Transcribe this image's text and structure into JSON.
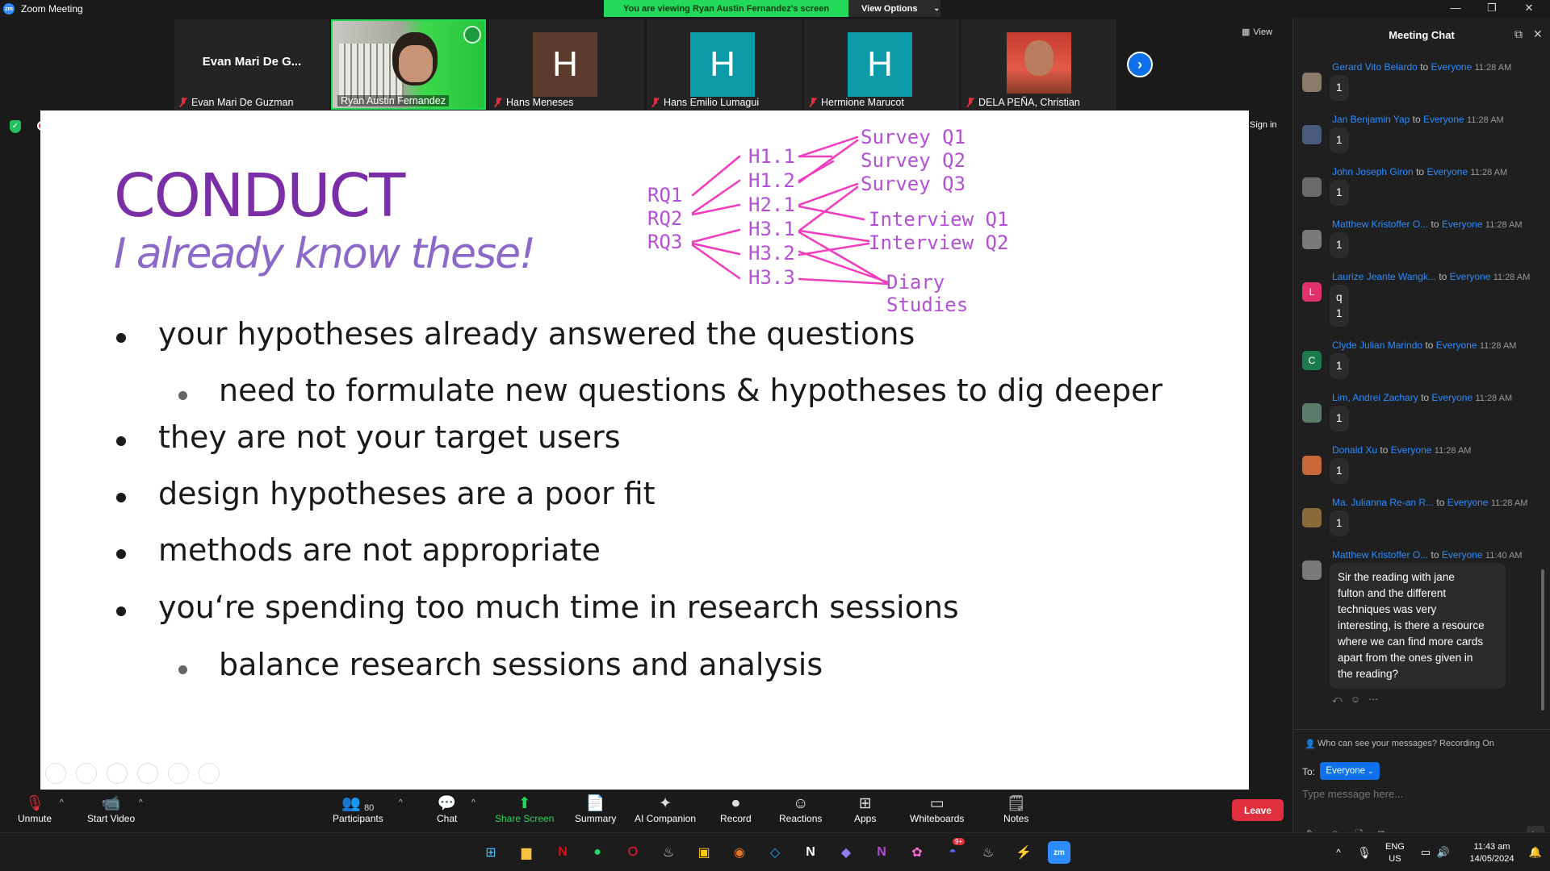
{
  "window": {
    "title": "Zoom Meeting",
    "logo_text": "zm"
  },
  "share_banner": {
    "viewing": "You are viewing Ryan Austin Fernandez's screen",
    "view_options": "View Options"
  },
  "gallery": {
    "view_label": "View",
    "participants": [
      {
        "name": "Evan Mari De Guzman",
        "big": "Evan Mari De G...",
        "type": "name"
      },
      {
        "name": "Ryan Austin Fernandez",
        "type": "video"
      },
      {
        "name": "Hans Meneses",
        "letter": "H",
        "color": "#5c3a2e"
      },
      {
        "name": "Hans Emilio Lumagui",
        "letter": "H",
        "color": "#0a9aa8"
      },
      {
        "name": "Hermione Marucot",
        "letter": "H",
        "color": "#0a9aa8"
      },
      {
        "name": "DELA PEÑA, Christian",
        "type": "video"
      }
    ]
  },
  "sign_in": "Sign in",
  "slide": {
    "title": "CONDUCT",
    "subtitle": "I already know these!",
    "bullets": [
      "your hypotheses already answered the questions",
      "need to formulate new questions & hypotheses to dig deeper",
      "they are not your target users",
      "design hypotheses are a poor fit",
      "methods are not appropriate",
      "you‘re spending too much time in research sessions",
      "balance research sessions and analysis"
    ],
    "diagram": {
      "rq": [
        "RQ1",
        "RQ2",
        "RQ3"
      ],
      "h": [
        "H1.1",
        "H1.2",
        "H2.1",
        "H3.1",
        "H3.2",
        "H3.3"
      ],
      "methods": [
        "Survey Q1",
        "Survey Q2",
        "Survey Q3",
        "Interview Q1",
        "Interview Q2",
        "Diary Studies"
      ]
    }
  },
  "toolbar": {
    "unmute": "Unmute",
    "start_video": "Start Video",
    "participants": "Participants",
    "participant_count": "80",
    "chat": "Chat",
    "share_screen": "Share Screen",
    "summary": "Summary",
    "ai_companion": "AI Companion",
    "record": "Record",
    "reactions": "Reactions",
    "apps": "Apps",
    "whiteboards": "Whiteboards",
    "notes": "Notes",
    "leave": "Leave"
  },
  "chat": {
    "title": "Meeting Chat",
    "messages": [
      {
        "sender": "Gerard Vito Belardo",
        "to": "to",
        "recipient": "Everyone",
        "time": "11:28 AM",
        "lines": [
          "1"
        ]
      },
      {
        "sender": "Jan Benjamin Yap",
        "to": "to",
        "recipient": "Everyone",
        "time": "11:28 AM",
        "lines": [
          "1"
        ]
      },
      {
        "sender": "John Joseph Giron",
        "to": "to",
        "recipient": "Everyone",
        "time": "11:28 AM",
        "lines": [
          "1"
        ]
      },
      {
        "sender": "Matthew Kristoffer O...",
        "to": "to",
        "recipient": "Everyone",
        "time": "11:28 AM",
        "lines": [
          "1"
        ]
      },
      {
        "sender": "Laurize Jeante Wangk...",
        "to": "to",
        "recipient": "Everyone",
        "time": "11:28 AM",
        "lines": [
          "q",
          "1"
        ],
        "initial": "L",
        "color": "#e0316e"
      },
      {
        "sender": "Clyde Julian Marindo",
        "to": "to",
        "recipient": "Everyone",
        "time": "11:28 AM",
        "lines": [
          "1"
        ],
        "initial": "C",
        "color": "#1b7b4d"
      },
      {
        "sender": "Lim, Andrei Zachary",
        "to": "to",
        "recipient": "Everyone",
        "time": "11:28 AM",
        "lines": [
          "1"
        ]
      },
      {
        "sender": "Donald Xu",
        "to": "to",
        "recipient": "Everyone",
        "time": "11:28 AM",
        "lines": [
          "1"
        ]
      },
      {
        "sender": "Ma. Julianna Re-an R...",
        "to": "to",
        "recipient": "Everyone",
        "time": "11:28 AM",
        "lines": [
          "1"
        ]
      },
      {
        "sender": "Matthew Kristoffer O...",
        "to": "to",
        "recipient": "Everyone",
        "time": "11:40 AM",
        "lines": [
          "Sir the reading with jane",
          "fulton and the different",
          "techniques was very",
          "interesting, is there a resource",
          "where we can find more cards",
          "apart from the ones given in",
          "the reading?"
        ]
      }
    ],
    "recording_note": "Who can see your messages? Recording On",
    "to_label": "To:",
    "to_value": "Everyone",
    "placeholder": "Type message here..."
  },
  "taskbar": {
    "lang": "ENG",
    "region": "US",
    "time": "11:43 am",
    "date": "14/05/2024",
    "badge": "9+"
  }
}
